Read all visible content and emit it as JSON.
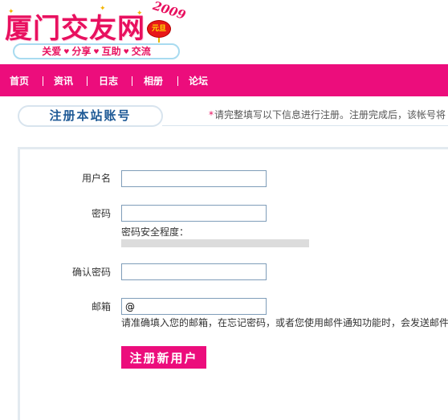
{
  "logo": {
    "title": "厦门交友网",
    "year": "2009",
    "lantern_text": "元旦",
    "slogan": [
      "关爱",
      "分享",
      "互助",
      "交流"
    ]
  },
  "nav": {
    "items": [
      "首页",
      "资讯",
      "日志",
      "相册",
      "论坛"
    ]
  },
  "section": {
    "title": "注册本站账号",
    "notice_star": "*",
    "notice": "请完整填写以下信息进行注册。注册完成后，该帐号将"
  },
  "form": {
    "username_label": "用户名",
    "username_value": "",
    "password_label": "密码",
    "password_value": "",
    "strength_label": "密码安全程度：",
    "strength_level": 0,
    "confirm_label": "确认密码",
    "confirm_value": "",
    "email_label": "邮箱",
    "email_value": "@",
    "email_hint": "请准确填入您的邮箱，在忘记密码，或者您使用邮件通知功能时，会发送邮件",
    "submit_label": "注册新用户"
  },
  "colors": {
    "brand_pink": "#ec0d7c",
    "tab_blue": "#1f5a96",
    "slogan_border": "#a8dbf0"
  }
}
